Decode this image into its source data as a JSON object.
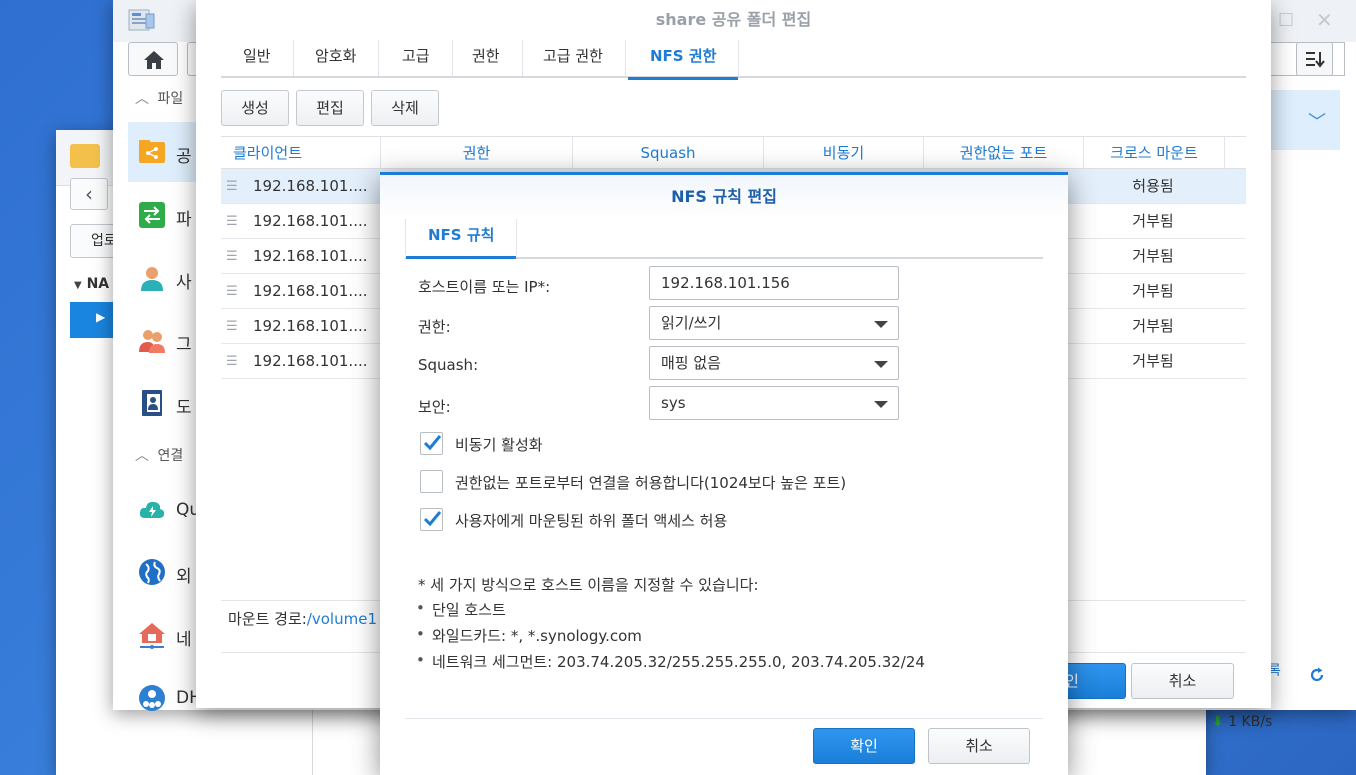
{
  "colors": {
    "accent": "#1f7cd4",
    "desktop": "#3a7bd5",
    "checkbox_check": "#1f7cd4"
  },
  "back_window": {
    "upload_label": "업로",
    "nav_label": "NA",
    "speed": "1 KB/s",
    "icons": [
      "folder-icon",
      "back-arrow-icon",
      "download-arrow-icon"
    ]
  },
  "control_panel": {
    "sections": [
      {
        "label": "파일"
      },
      {
        "label": "연결"
      }
    ],
    "items": [
      {
        "label": "공",
        "icon": "shared-folder-icon"
      },
      {
        "label": "파",
        "icon": "file-services-icon"
      },
      {
        "label": "사",
        "icon": "user-icon"
      },
      {
        "label": "그",
        "icon": "group-icon"
      },
      {
        "label": "도",
        "icon": "domain-icon"
      },
      {
        "label": "Qu",
        "icon": "quickconnect-icon"
      },
      {
        "label": "외",
        "icon": "external-access-icon"
      },
      {
        "label": "네",
        "icon": "network-icon"
      },
      {
        "label": "DH",
        "icon": "dhcp-icon"
      }
    ],
    "bottom_tool_label": "록"
  },
  "share_dialog": {
    "title": "share 공유 폴더 편집",
    "tabs": [
      "일반",
      "암호화",
      "고급",
      "권한",
      "고급 권한",
      "NFS 권한"
    ],
    "active_tab": "NFS 권한",
    "toolbar": {
      "create": "생성",
      "edit": "편집",
      "delete": "삭제"
    },
    "columns": [
      "클라이언트",
      "권한",
      "Squash",
      "비동기",
      "권한없는 포트",
      "크로스 마운트"
    ],
    "rows": [
      {
        "client": "192.168.101....",
        "cross_mount": "허용됨"
      },
      {
        "client": "192.168.101....",
        "cross_mount": "거부됨"
      },
      {
        "client": "192.168.101....",
        "cross_mount": "거부됨"
      },
      {
        "client": "192.168.101....",
        "cross_mount": "거부됨"
      },
      {
        "client": "192.168.101....",
        "cross_mount": "거부됨"
      },
      {
        "client": "192.168.101....",
        "cross_mount": "거부됨"
      }
    ],
    "mount_path_label": "마운트 경로:",
    "mount_path_value": "/volume1",
    "ok_label": "인",
    "cancel_label": "취소"
  },
  "nfs_dialog": {
    "title": "NFS 규칙 편집",
    "tab": "NFS 규칙",
    "fields": {
      "host_label": "호스트이름 또는 IP*:",
      "host_value": "192.168.101.156",
      "privilege_label": "권한:",
      "privilege_value": "읽기/쓰기",
      "squash_label": "Squash:",
      "squash_value": "매핑 없음",
      "security_label": "보안:",
      "security_value": "sys"
    },
    "checkboxes": [
      {
        "label": "비동기 활성화",
        "checked": true
      },
      {
        "label": "권한없는 포트로부터 연결을 허용합니다(1024보다 높은 포트)",
        "checked": false
      },
      {
        "label": "사용자에게 마운팅된 하위 폴더 액세스 허용",
        "checked": true
      }
    ],
    "note": "* 세 가지 방식으로 호스트 이름을 지정할 수 있습니다:",
    "bullets": [
      "단일 호스트",
      "와일드카드: *, *.synology.com",
      "네트워크 세그먼트: 203.74.205.32/255.255.255.0, 203.74.205.32/24"
    ],
    "ok_label": "확인",
    "cancel_label": "취소"
  }
}
